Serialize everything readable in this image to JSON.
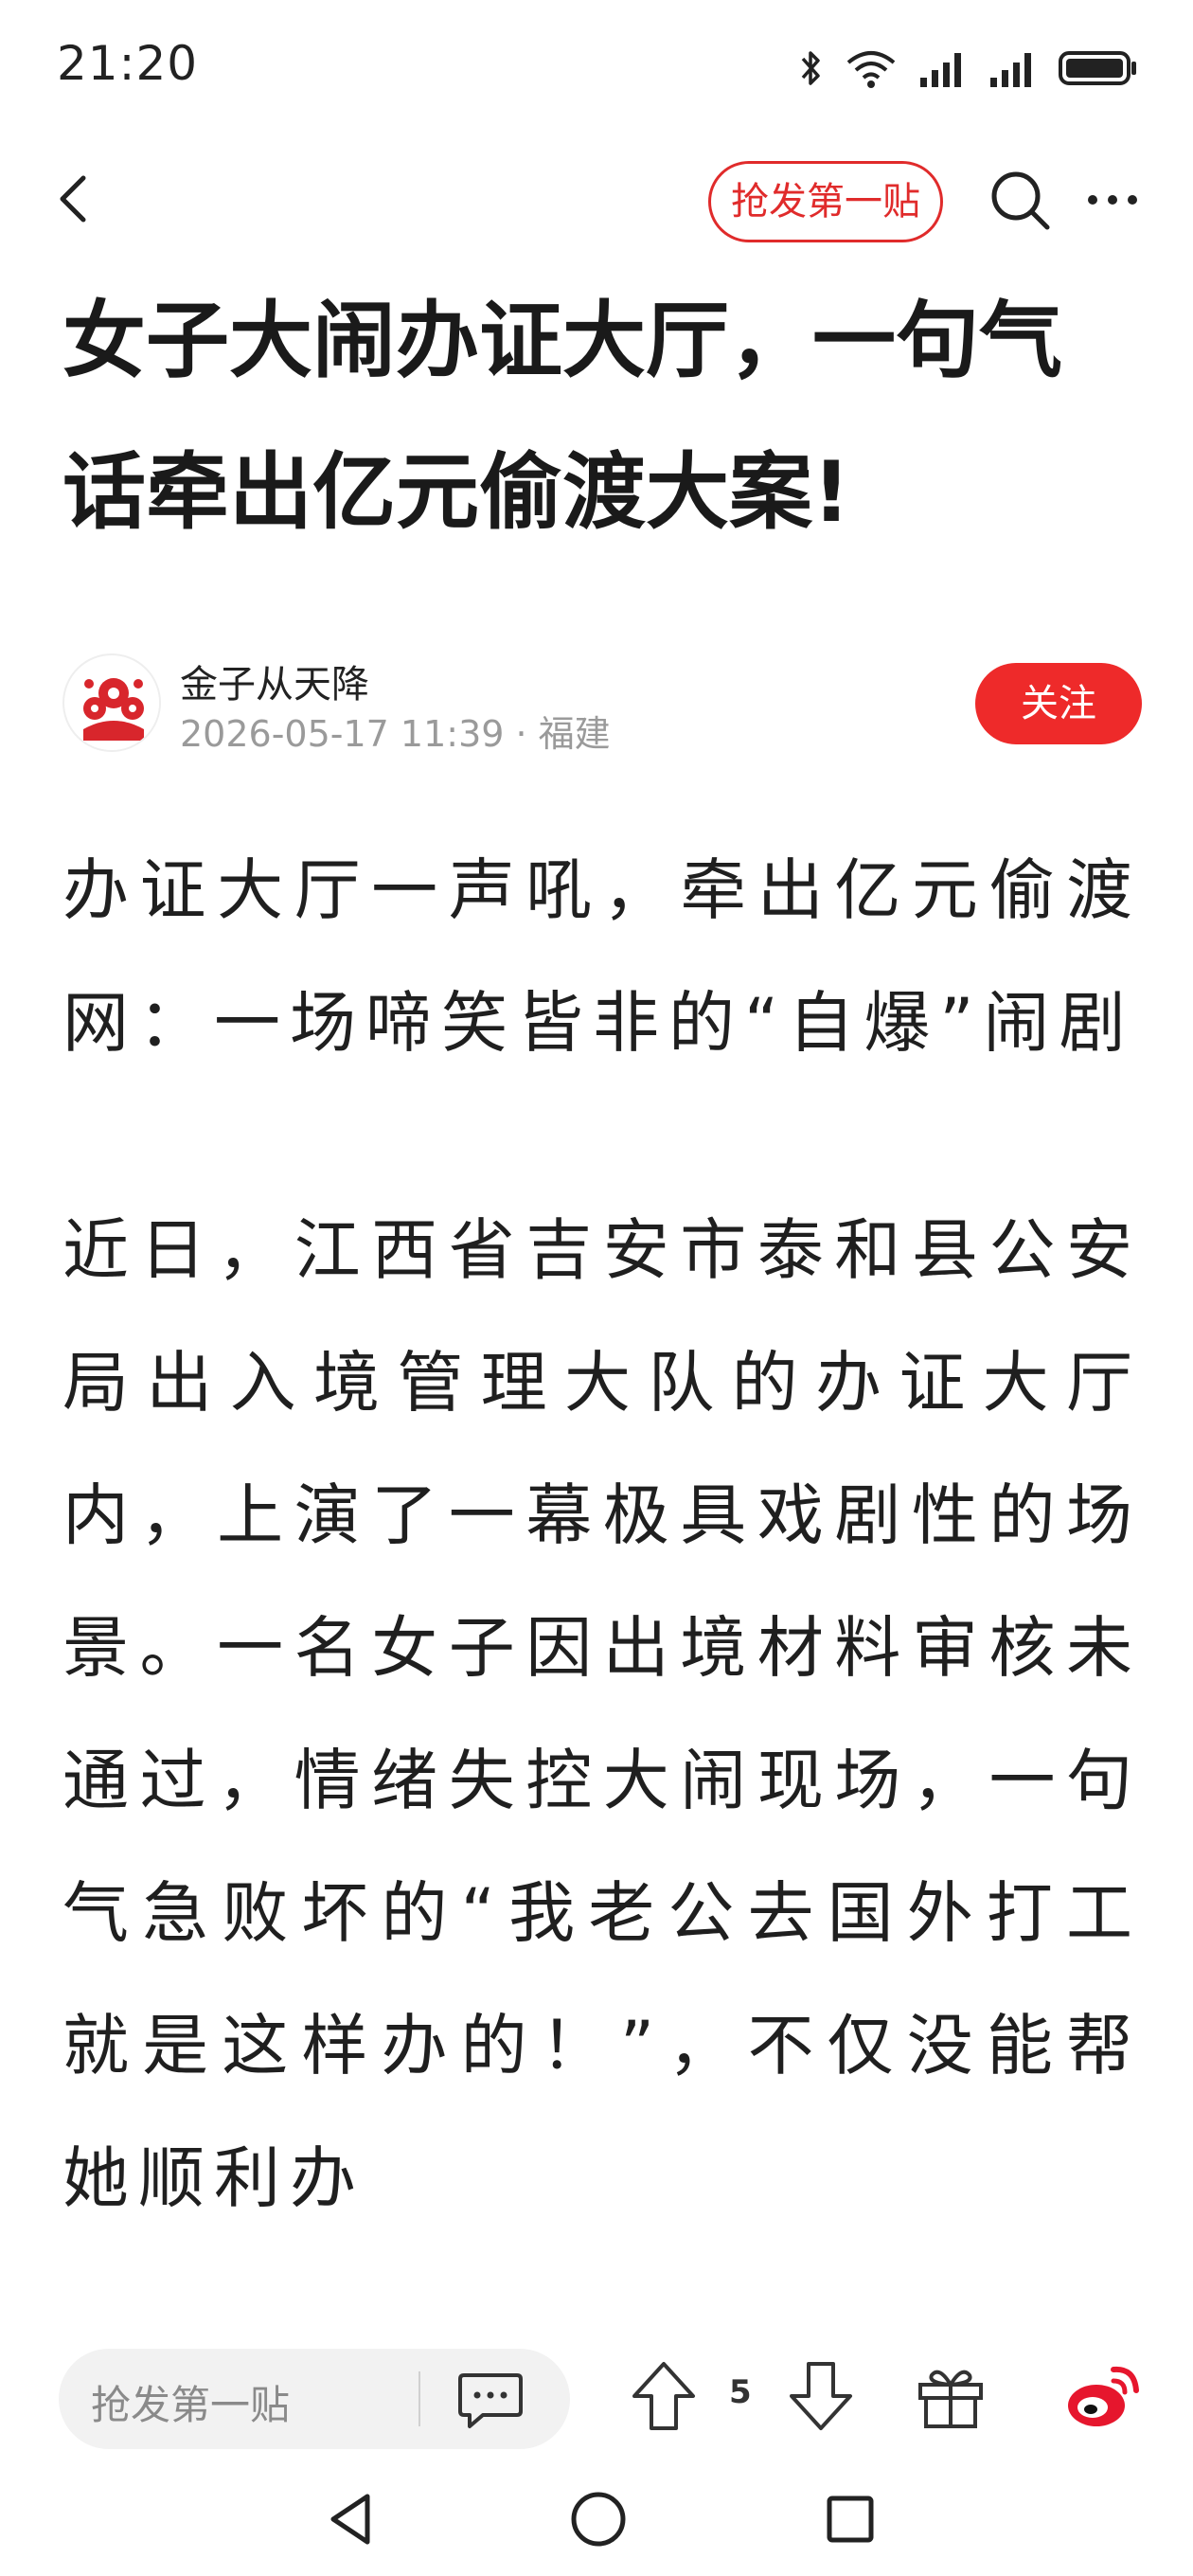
{
  "status_bar": {
    "time": "21:20",
    "icons": [
      "bluetooth-icon",
      "wifi-icon",
      "signal-icon",
      "signal-icon",
      "battery-icon"
    ]
  },
  "nav": {
    "back_icon": "chevron-left-icon",
    "first_post_label": "抢发第一贴",
    "search_icon": "search-icon",
    "more_icon": "more-icon"
  },
  "article": {
    "title": "女子大闹办证大厅，一句气话牵出亿元偷渡大案!",
    "author": {
      "name": "金子从天降",
      "meta": "2026-05-17 11:39 · 福建",
      "follow_label": "关注"
    },
    "paragraphs": [
      "办证大厅一声吼，牵出亿元偷渡网：一场啼笑皆非的“自爆”闹剧",
      "近日，江西省吉安市泰和县公安局出入境管理大队的办证大厅内，上演了一幕极具戏剧性的场景。一名女子因出境材料审核未通过，情绪失控大闹现场，一句气急败坏的“我老公去国外打工就是这样办的！”，不仅没能帮她顺利办"
    ]
  },
  "action_bar": {
    "comment_placeholder": "抢发第一贴",
    "vote_count": "5"
  },
  "colors": {
    "accent": "#e02b2b",
    "follow_bg": "#ee2a2a",
    "meta_text": "#9a9a9a"
  }
}
